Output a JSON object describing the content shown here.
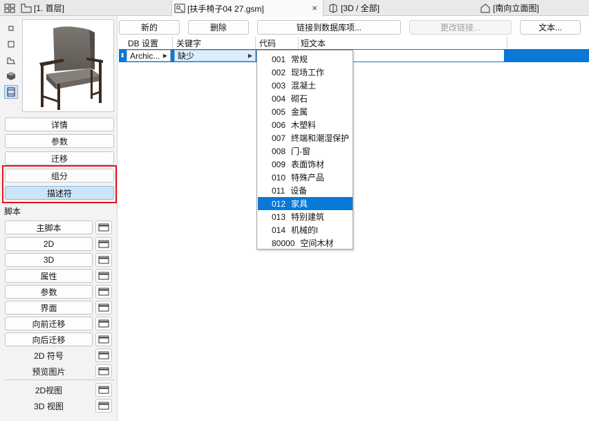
{
  "tabs": [
    {
      "label": "[1. 首层]",
      "icon": "floorplan-icon"
    },
    {
      "label": "[扶手椅子04 27.gsm]",
      "icon": "gsm-object-icon",
      "close": "×"
    },
    {
      "label": "[3D / 全部]",
      "icon": "3d-view-icon"
    },
    {
      "label": "[南向立面图]",
      "icon": "elevation-icon"
    }
  ],
  "left": {
    "buttons": [
      "详情",
      "参数",
      "迁移",
      "组分",
      "描述符"
    ],
    "selected_button": "描述符",
    "section_label": "脚本",
    "scripts": [
      "主脚本",
      "2D",
      "3D",
      "属性",
      "参数",
      "界面",
      "向前迁移",
      "向后迁移"
    ],
    "static_items": [
      "2D 符号",
      "预览图片"
    ],
    "views": [
      "2D视图",
      "3D 视图"
    ]
  },
  "toolbar": {
    "new_label": "新的",
    "delete_label": "删除",
    "link_db_label": "链接到数据库项...",
    "change_link_label": "更改链接...",
    "text_label": "文本..."
  },
  "table": {
    "headers": [
      "DB 设置",
      "关键字",
      "代码",
      "短文本"
    ],
    "row": {
      "db": "Archic...",
      "keyword": "缺少"
    }
  },
  "dropdown": {
    "items": [
      {
        "code": "001",
        "label": "常规"
      },
      {
        "code": "002",
        "label": "现场工作"
      },
      {
        "code": "003",
        "label": "混凝土"
      },
      {
        "code": "004",
        "label": "砌石"
      },
      {
        "code": "005",
        "label": "金属"
      },
      {
        "code": "006",
        "label": "木塑料"
      },
      {
        "code": "007",
        "label": "终端和潮湿保护"
      },
      {
        "code": "008",
        "label": "门-窗"
      },
      {
        "code": "009",
        "label": "表面饰材"
      },
      {
        "code": "010",
        "label": "特殊产品"
      },
      {
        "code": "011",
        "label": "设备"
      },
      {
        "code": "012",
        "label": "家具"
      },
      {
        "code": "013",
        "label": "特别建筑"
      },
      {
        "code": "014",
        "label": "机械的l"
      },
      {
        "code": "80000",
        "label": "空间木材"
      }
    ],
    "selected": "012"
  },
  "colors": {
    "selection": "#0a78d7",
    "highlight_box": "#e8141b",
    "selected_button": "#cce4f7"
  }
}
